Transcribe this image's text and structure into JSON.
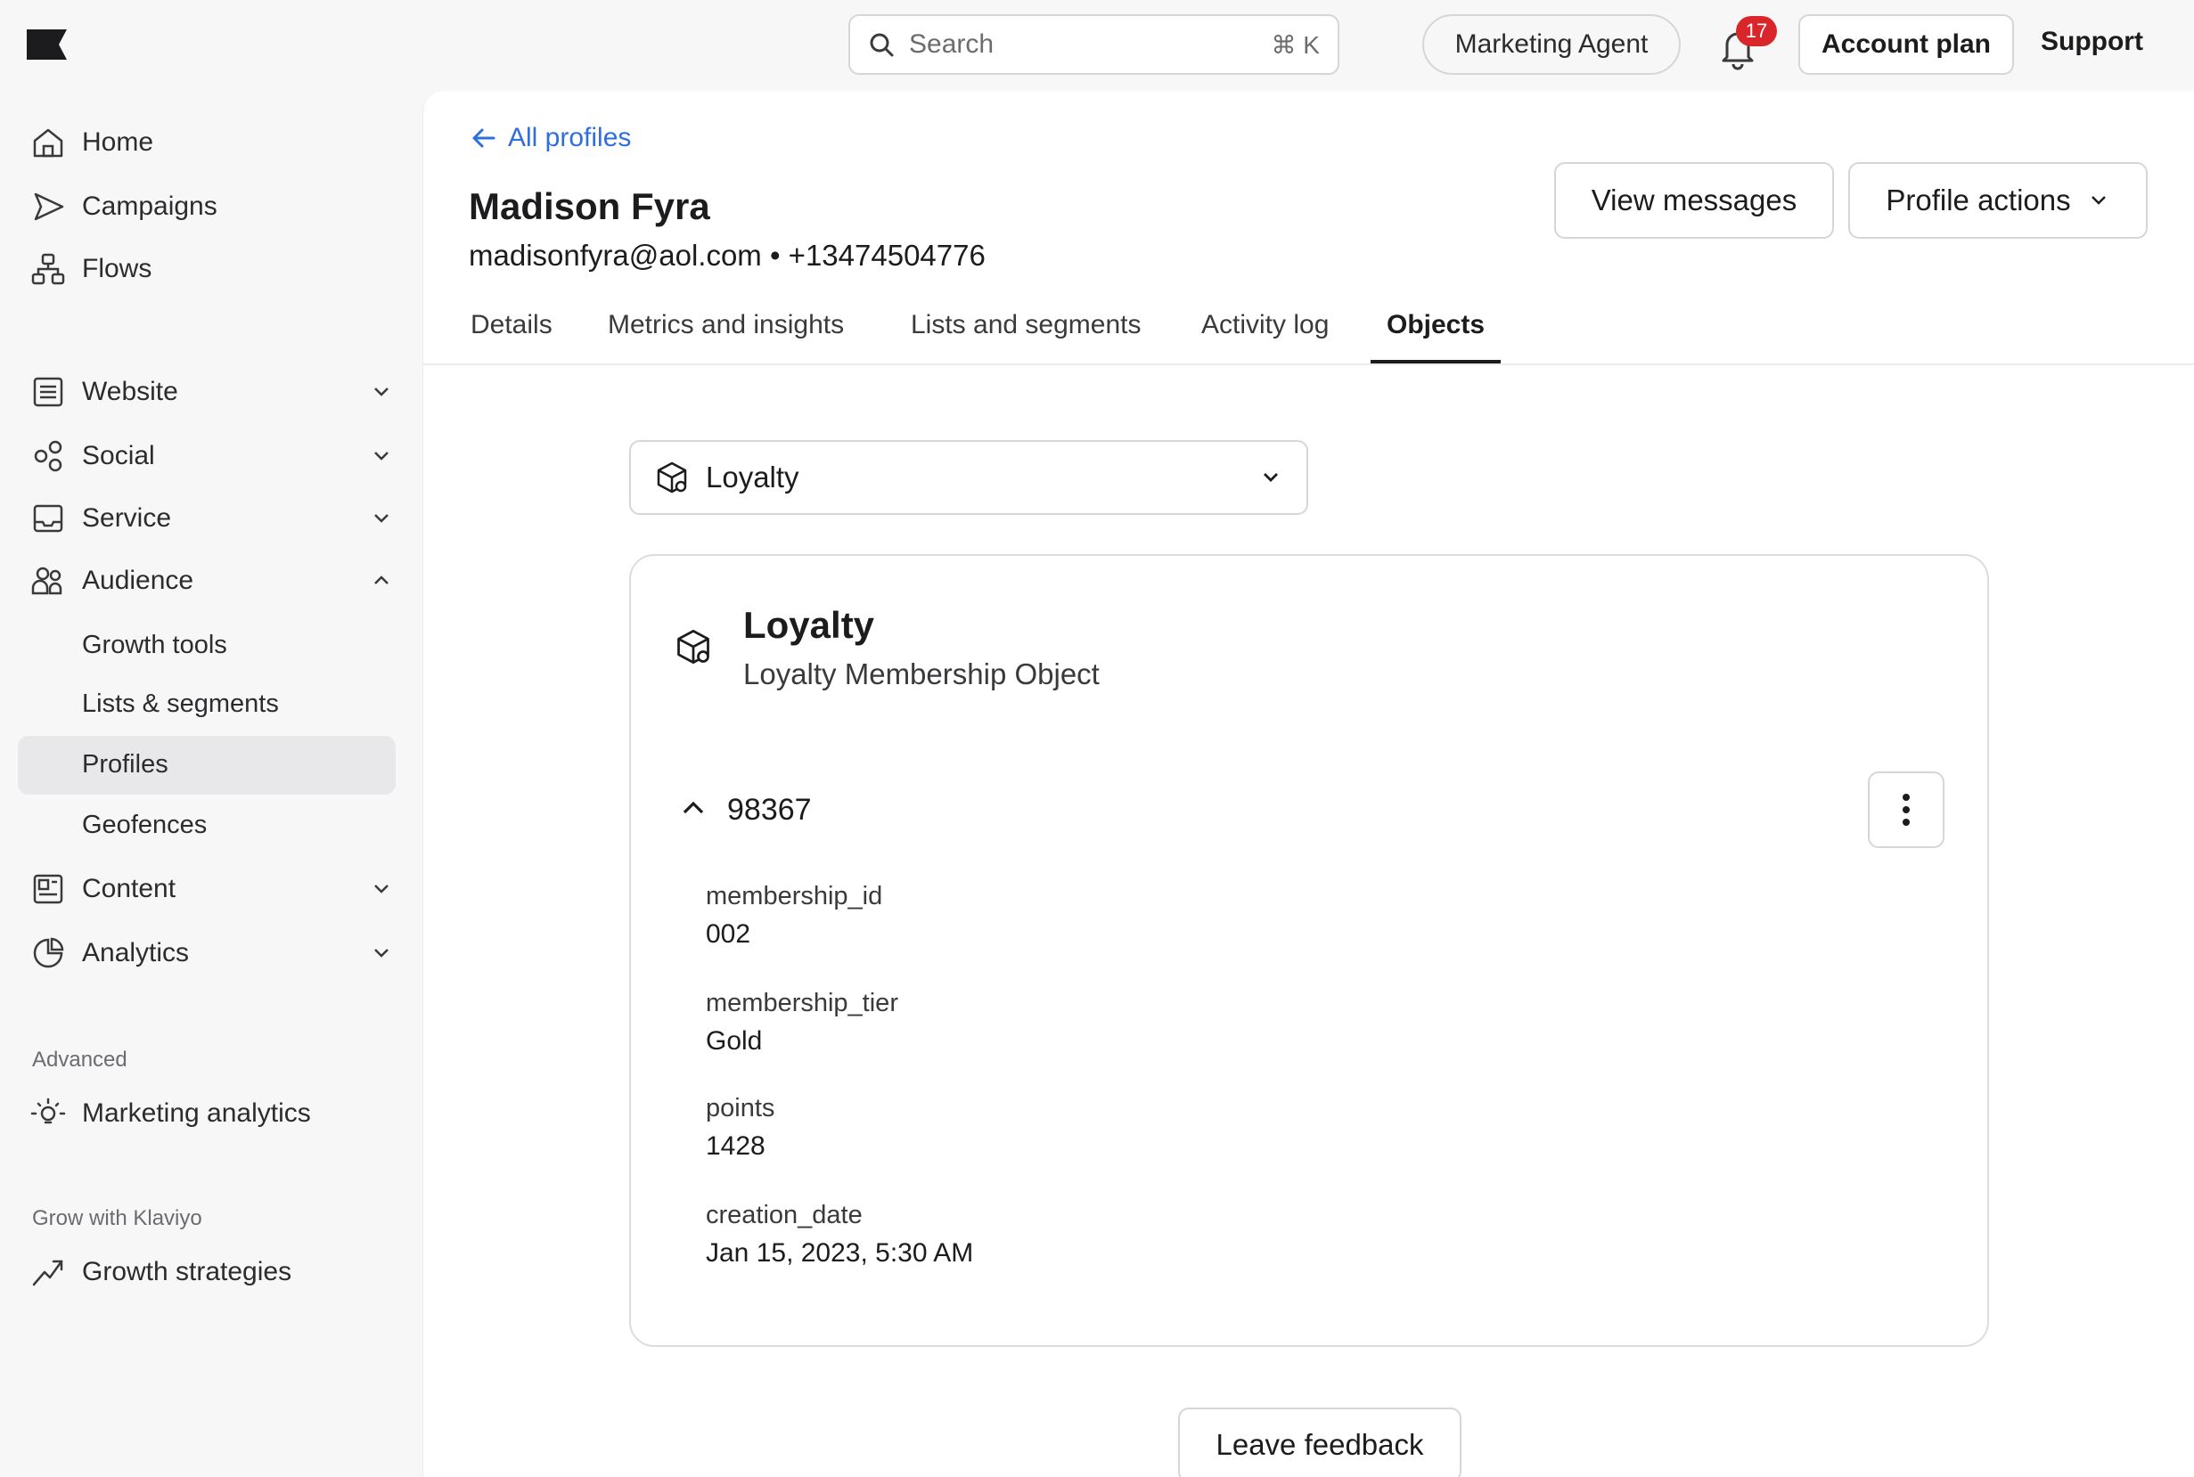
{
  "topbar": {
    "search_placeholder": "Search",
    "search_shortcut": "⌘ K",
    "marketing_agent": "Marketing Agent",
    "notification_count": "17",
    "account_plan": "Account plan",
    "support": "Support"
  },
  "sidebar": {
    "home": "Home",
    "campaigns": "Campaigns",
    "flows": "Flows",
    "website": "Website",
    "social": "Social",
    "service": "Service",
    "audience": "Audience",
    "audience_items": [
      "Growth tools",
      "Lists & segments",
      "Profiles",
      "Geofences"
    ],
    "content": "Content",
    "analytics": "Analytics",
    "section_advanced": "Advanced",
    "marketing_analytics": "Marketing analytics",
    "section_grow": "Grow with Klaviyo",
    "growth_strategies": "Growth strategies"
  },
  "profile": {
    "back_label": "All profiles",
    "name": "Madison Fyra",
    "contact": "madisonfyra@aol.com • +13474504776",
    "view_messages": "View messages",
    "profile_actions": "Profile actions"
  },
  "tabs": [
    "Details",
    "Metrics and insights",
    "Lists and segments",
    "Activity log",
    "Objects"
  ],
  "objects": {
    "selected_object": "Loyalty",
    "card_title": "Loyalty",
    "card_subtitle": "Loyalty Membership Object",
    "record_id": "98367",
    "fields": [
      {
        "key": "membership_id",
        "value": "002"
      },
      {
        "key": "membership_tier",
        "value": "Gold"
      },
      {
        "key": "points",
        "value": "1428"
      },
      {
        "key": "creation_date",
        "value": "Jan 15, 2023, 5:30 AM"
      }
    ]
  },
  "feedback_label": "Leave feedback",
  "colors": {
    "accent_link": "#2f6fdc",
    "badge": "#d9262a",
    "active_nav_bg": "#e8e8ea"
  }
}
